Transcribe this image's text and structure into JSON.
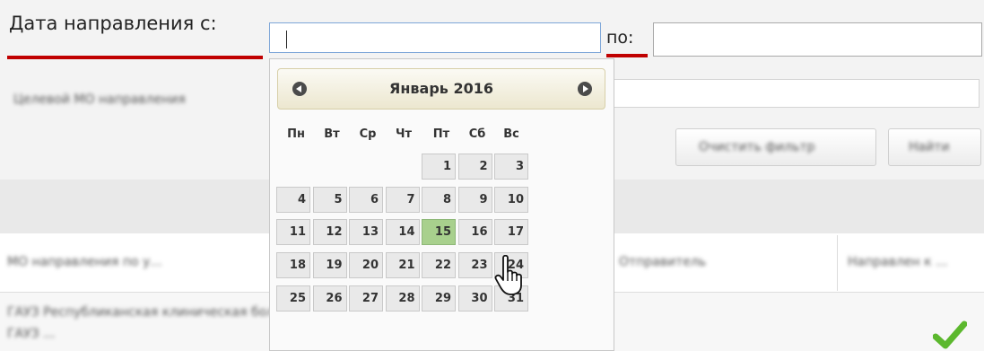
{
  "form": {
    "date_from_label": "Дата направления с:",
    "date_from_value": "",
    "date_to_label": "по:",
    "date_to_value": ""
  },
  "background": {
    "field2_label": "Целевой МО направления",
    "button_clear": "Очистить фильтр",
    "button_find": "Найти",
    "row1_col1": "МО направления по у...",
    "row1_col3": "Отправитель",
    "row1_col4": "Направлен к ...",
    "row2_col1": "ГАУЗ Республиканская клиническая больница",
    "row2_col1b": "ГАУЗ ...",
    "row2_status": "check-icon"
  },
  "calendar": {
    "month_title": "Январь 2016",
    "prev_icon": "chevron-left-circle-icon",
    "next_icon": "chevron-right-circle-icon",
    "weekdays": [
      "Пн",
      "Вт",
      "Ср",
      "Чт",
      "Пт",
      "Сб",
      "Вс"
    ],
    "first_weekday_index": 4,
    "days": [
      "1",
      "2",
      "3",
      "4",
      "5",
      "6",
      "7",
      "8",
      "9",
      "10",
      "11",
      "12",
      "13",
      "14",
      "15",
      "16",
      "17",
      "18",
      "19",
      "20",
      "21",
      "22",
      "23",
      "24",
      "25",
      "26",
      "27",
      "28",
      "29",
      "30",
      "31"
    ],
    "selected_day": "15",
    "colors": {
      "selected": "#a8d08d",
      "day": "#e9e9e9",
      "header": "#ece7cf"
    }
  },
  "colors": {
    "underline": "#c00000",
    "input_focus_border": "#7ea6d8",
    "check": "#5cb82e"
  }
}
